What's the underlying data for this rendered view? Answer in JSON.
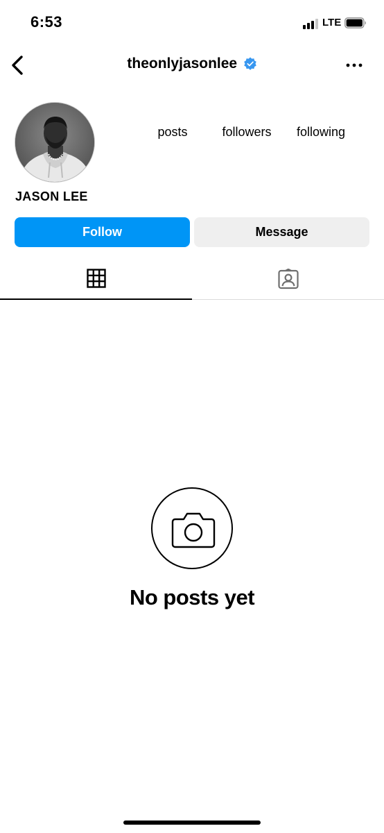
{
  "status_bar": {
    "time": "6:53",
    "network": "LTE",
    "signal_bars_filled": 3,
    "signal_bars_total": 4,
    "battery_level": 0.95
  },
  "header": {
    "username": "theonlyjasonlee",
    "verified": true,
    "back_icon": "chevron-left-icon",
    "more_icon": "more-horizontal-icon",
    "verified_color": "#3897f0"
  },
  "profile": {
    "display_name": "JASON LEE",
    "stats": {
      "posts_label": "posts",
      "followers_label": "followers",
      "following_label": "following"
    }
  },
  "actions": {
    "follow_label": "Follow",
    "message_label": "Message",
    "follow_color": "#0095f6"
  },
  "tabs": [
    {
      "name": "grid",
      "icon": "grid-icon",
      "active": true
    },
    {
      "name": "tagged",
      "icon": "tagged-icon",
      "active": false
    }
  ],
  "empty_state": {
    "icon": "camera-icon",
    "title": "No posts yet"
  }
}
